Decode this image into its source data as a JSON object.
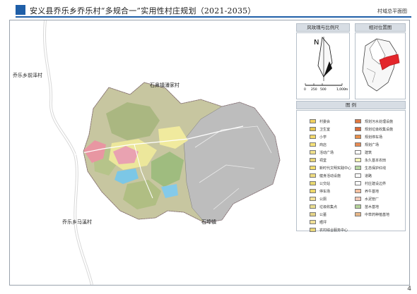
{
  "title": "安义县乔乐乡乔乐村“多规合一”实用性村庄规划（2021-2035）",
  "sheet_label": "村域总平面图",
  "page_number": "4",
  "map_labels": {
    "nw": "乔乐乡前泽村",
    "ne": "石鼻镇潘家村",
    "sw": "乔乐乡马溪村",
    "se": "石埠镇"
  },
  "compass_panel": {
    "title": "风玫瑰与比例尺",
    "north": "N",
    "scale_ticks": [
      "0",
      "250",
      "500",
      "1,000"
    ],
    "scale_unit": "m"
  },
  "location_panel": {
    "title": "相对位置图"
  },
  "legend": {
    "title": "图  例",
    "left_items": [
      {
        "label": "村委会",
        "color": "#f0d060"
      },
      {
        "label": "卫生室",
        "color": "#e8c850"
      },
      {
        "label": "小学",
        "color": "#f3d86a"
      },
      {
        "label": "商店",
        "color": "#f6e27a"
      },
      {
        "label": "活动广场",
        "color": "#efe08a"
      },
      {
        "label": "祠堂",
        "color": "#e9d67a"
      },
      {
        "label": "新时代文明实践中心",
        "color": "#f3de6e"
      },
      {
        "label": "健身活动设施",
        "color": "#eedb80"
      },
      {
        "label": "公交站",
        "color": "#e8d870"
      },
      {
        "label": "停车场",
        "color": "#eed86a"
      },
      {
        "label": "公厕",
        "color": "#f5e39a"
      },
      {
        "label": "垃圾收集点",
        "color": "#e9dc8e"
      },
      {
        "label": "公墓",
        "color": "#e5d488"
      },
      {
        "label": "晒坪",
        "color": "#f0e096"
      },
      {
        "label": "农村综合服务中心",
        "color": "#e8d678"
      }
    ],
    "right_items": [
      {
        "label": "规划污水处理设施",
        "color": "#e07840"
      },
      {
        "label": "规划垃圾收集设施",
        "color": "#d96a38"
      },
      {
        "label": "规划停车场",
        "color": "#e8904a"
      },
      {
        "label": "规划广场",
        "color": "#e88a52"
      },
      {
        "label": "建筑",
        "color": "#ffffff"
      },
      {
        "label": "永久基本农田",
        "color": "#f7f7b8"
      },
      {
        "label": "生态保护红线",
        "color": "#b7d7a0"
      },
      {
        "label": "道路",
        "color": "#ffffff"
      },
      {
        "label": "村庄建设边界",
        "color": "#ffffff"
      },
      {
        "label": "养牛基地",
        "color": "#f4c0a0"
      },
      {
        "label": "水泥管厂",
        "color": "#f2c8b6"
      },
      {
        "label": "苗木基地",
        "color": "#b5d39a"
      },
      {
        "label": "中草药种植基地",
        "color": "#e7b788"
      }
    ]
  },
  "colors": {
    "title_blue": "#1f5fa8",
    "panel_bg": "#d7dde4",
    "highlight": "#e3262b"
  }
}
